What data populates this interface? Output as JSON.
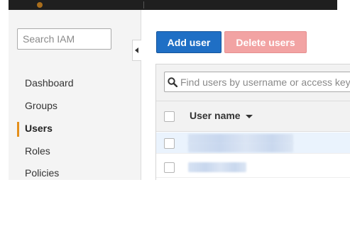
{
  "sidebar": {
    "search_placeholder": "Search IAM",
    "items": [
      {
        "label": "Dashboard"
      },
      {
        "label": "Groups"
      },
      {
        "label": "Users"
      },
      {
        "label": "Roles"
      },
      {
        "label": "Policies"
      }
    ],
    "active_item": "Users",
    "accent_color": "#e48f1b"
  },
  "toolbar": {
    "add_label": "Add user",
    "delete_label": "Delete users",
    "add_color": "#1f6fc5",
    "delete_color": "#f2a3a3"
  },
  "users_table": {
    "find_placeholder": "Find users by username or access key",
    "columns": [
      {
        "label": "User name",
        "sort": "descending"
      }
    ],
    "rows": [
      {
        "user_name": "",
        "selected": true
      },
      {
        "user_name": "",
        "selected": false
      }
    ]
  },
  "icons": {
    "collapse": "chevron-left-icon",
    "find": "search-icon",
    "sort": "caret-down-icon"
  }
}
